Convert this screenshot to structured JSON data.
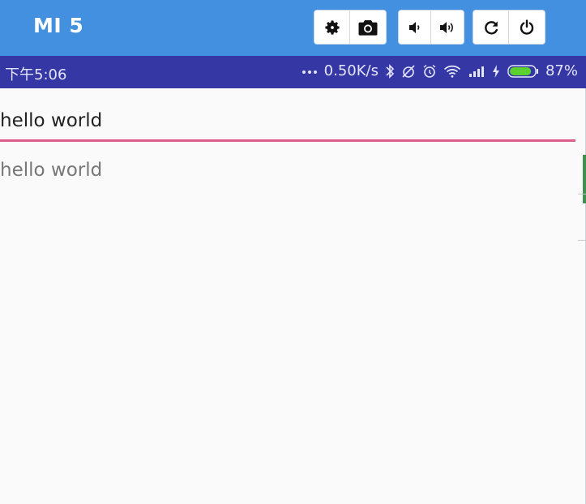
{
  "emulator": {
    "device_name": "MI 5",
    "toolbar": {
      "settings": "gear-icon",
      "screenshot": "camera-icon",
      "volume_down": "volume-down-icon",
      "volume_up": "volume-up-icon",
      "rotate": "rotate-icon",
      "power": "power-icon"
    }
  },
  "status_bar": {
    "time": "下午5:06",
    "net_speed": "0.50K/s",
    "battery_percent": "87%",
    "battery_level": 0.87,
    "colors": {
      "background": "#3437a4",
      "battery": "#5ad12f"
    }
  },
  "app": {
    "input_value": "hello world",
    "echo_text": "hello world",
    "colors": {
      "accent": "#e05c8a",
      "topbar": "#4390e0"
    }
  }
}
